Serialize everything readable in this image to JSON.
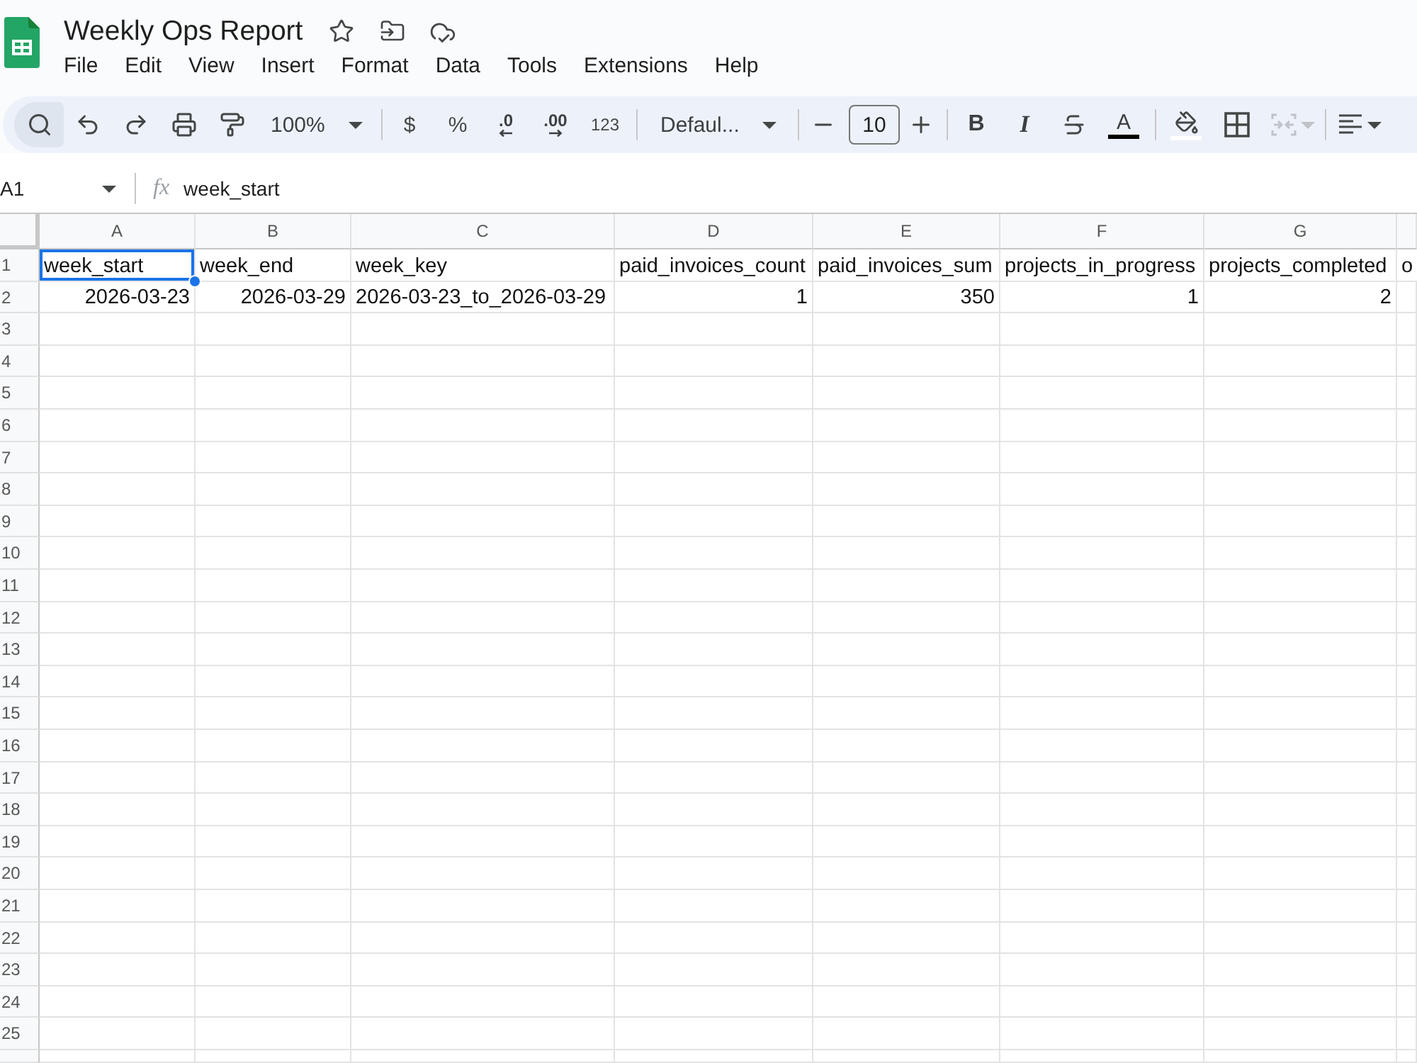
{
  "document": {
    "title": "Weekly Ops Report",
    "starred": false
  },
  "menu": [
    "File",
    "Edit",
    "View",
    "Insert",
    "Format",
    "Data",
    "Tools",
    "Extensions",
    "Help"
  ],
  "toolbar": {
    "zoom": "100%",
    "currency": "$",
    "percent": "%",
    "decrease_decimal": ".0",
    "increase_decimal": ".00",
    "number_format": "123",
    "font": "Defaul...",
    "font_size": "10",
    "bold": "B",
    "italic": "I",
    "text_color": "A",
    "merge": {
      "disabled": true
    }
  },
  "formula_bar": {
    "name_box": "A1",
    "function_label": "fx",
    "formula": "week_start"
  },
  "columns": [
    {
      "letter": "A"
    },
    {
      "letter": "B"
    },
    {
      "letter": "C"
    },
    {
      "letter": "D"
    },
    {
      "letter": "E"
    },
    {
      "letter": "F"
    },
    {
      "letter": "G"
    }
  ],
  "rows": [
    {
      "number": "1",
      "cells": [
        {
          "text": "week_start",
          "kind": "text",
          "selected": true
        },
        {
          "text": "week_end",
          "kind": "text",
          "selected": false
        },
        {
          "text": "week_key",
          "kind": "text",
          "selected": false
        },
        {
          "text": "paid_invoices_count",
          "kind": "text",
          "selected": false
        },
        {
          "text": "paid_invoices_sum",
          "kind": "text",
          "selected": false
        },
        {
          "text": "projects_in_progress",
          "kind": "text",
          "selected": false
        },
        {
          "text": "projects_completed",
          "kind": "text",
          "selected": false
        },
        {
          "text": "o",
          "kind": "text",
          "selected": false
        }
      ]
    },
    {
      "number": "2",
      "cells": [
        {
          "text": "2026-03-23",
          "kind": "date",
          "selected": false
        },
        {
          "text": "2026-03-29",
          "kind": "date",
          "selected": false
        },
        {
          "text": "2026-03-23_to_2026-03-29",
          "kind": "text",
          "selected": false
        },
        {
          "text": "1",
          "kind": "number",
          "selected": false
        },
        {
          "text": "350",
          "kind": "number",
          "selected": false
        },
        {
          "text": "1",
          "kind": "number",
          "selected": false
        },
        {
          "text": "2",
          "kind": "number",
          "selected": false
        }
      ]
    },
    {
      "number": "3"
    },
    {
      "number": "4"
    },
    {
      "number": "5"
    },
    {
      "number": "6"
    },
    {
      "number": "7"
    },
    {
      "number": "8"
    },
    {
      "number": "9"
    },
    {
      "number": "10"
    },
    {
      "number": "11"
    },
    {
      "number": "12"
    },
    {
      "number": "13"
    },
    {
      "number": "14"
    },
    {
      "number": "15"
    },
    {
      "number": "16"
    },
    {
      "number": "17"
    },
    {
      "number": "18"
    },
    {
      "number": "19"
    },
    {
      "number": "20"
    },
    {
      "number": "21"
    },
    {
      "number": "22"
    },
    {
      "number": "23"
    },
    {
      "number": "24"
    },
    {
      "number": "25"
    }
  ]
}
